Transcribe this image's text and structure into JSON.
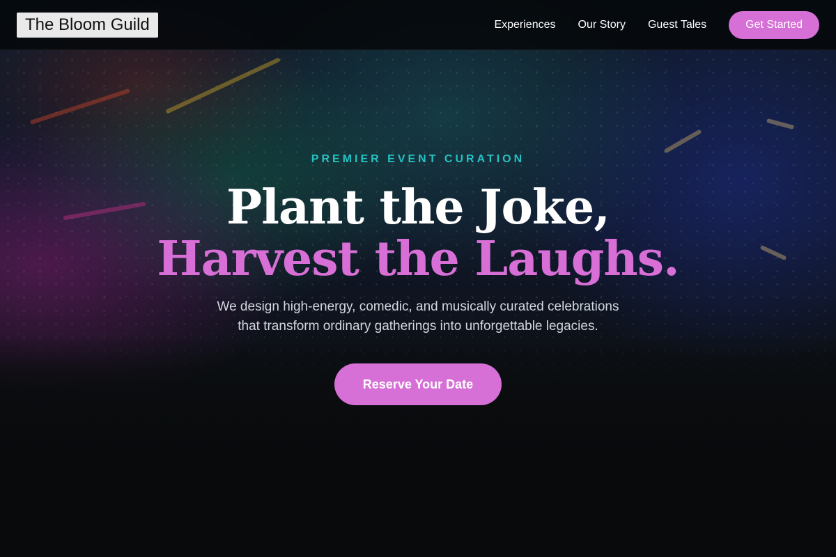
{
  "brand": {
    "name": "The Bloom Guild"
  },
  "nav": {
    "items": [
      {
        "label": "Experiences"
      },
      {
        "label": "Our Story"
      },
      {
        "label": "Guest Tales"
      }
    ],
    "cta_label": "Get Started"
  },
  "hero": {
    "eyebrow": "PREMIER EVENT CURATION",
    "headline_line1": "Plant the Joke,",
    "headline_line2": "Harvest the Laughs.",
    "subtext_line1": "We design high-energy, comedic, and musically curated celebrations",
    "subtext_line2": "that transform ordinary gatherings into unforgettable legacies.",
    "cta_label": "Reserve Your Date"
  },
  "colors": {
    "accent": "#d66fd6",
    "eyebrow": "#26c2c2",
    "header_bg": "#05080a"
  }
}
